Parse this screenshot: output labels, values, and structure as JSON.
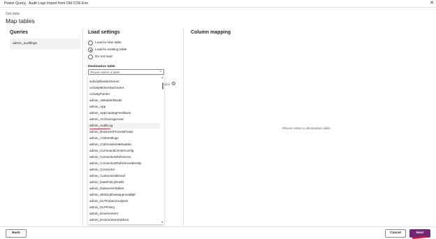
{
  "titlebar": {
    "app": "Power Query",
    "title": "Audit Logs Import from Old COE Env",
    "close_icon": "close-icon"
  },
  "page": {
    "step": "Get data",
    "title": "Map tables"
  },
  "queries": {
    "heading": "Queries",
    "items": [
      "admin_auditlogs"
    ]
  },
  "load_settings": {
    "heading": "Load settings",
    "options": [
      {
        "label": "Load to new table",
        "selected": false
      },
      {
        "label": "Load to existing table",
        "selected": true
      },
      {
        "label": "Do not load",
        "selected": false
      }
    ],
    "destination_label": "Destination table",
    "destination_placeholder": "Please select a table",
    "hidden_text": "nput",
    "info_icon": "info-icon"
  },
  "dropdown": {
    "items": [
      "activityfileattachment",
      "activityfileattachment",
      "ActivityMimeAttachment",
      "ActivityPointer",
      "admin_AIBuilderModel",
      "admin_App",
      "admin_AppCatalogFeedback",
      "admin_ArchiveApproval",
      "admin_AuditLog",
      "admin_BusinessProcessFlows",
      "admin_COESettings",
      "admin_CoESolutionMetadata",
      "admin_CommandCenterConfig",
      "admin_ConnectionReference",
      "admin_ConnectionReferenceIdentity",
      "admin_Connector",
      "admin_CustomizedEmail",
      "admin_DataPolicyDrafts",
      "admin_DataverseTables",
      "admin_desktopflowsapproval$pf",
      "admin_DLPImpactAnalysis",
      "admin_DLPPolicy",
      "admin_Environment",
      "admin_EnvironmentAddons"
    ],
    "highlighted": "admin_AuditLog"
  },
  "column_mapping": {
    "heading": "Column mapping",
    "placeholder": "Please select a destination table."
  },
  "footer": {
    "back": "Back",
    "cancel": "Cancel",
    "next": "Next"
  },
  "colors": {
    "accent": "#742774",
    "annotation": "#e81123"
  }
}
